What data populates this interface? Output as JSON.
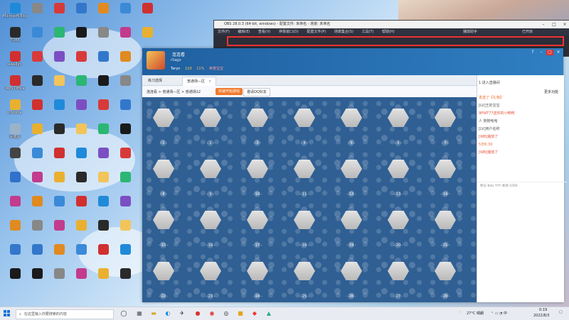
{
  "desktop_icons": [
    {
      "label": "Microsoft Edge",
      "color": "#1f8ad9"
    },
    {
      "label": "TOBE",
      "color": "#2a2a2a"
    },
    {
      "label": "ewellyn",
      "color": "#d03030"
    },
    {
      "label": "WPS Office",
      "color": "#d03030"
    },
    {
      "label": "Chrome",
      "color": "#e9b030"
    },
    {
      "label": "回收站",
      "color": "#9bb3c9"
    },
    {
      "label": "",
      "color": "#444"
    },
    {
      "label": "",
      "color": "#3071c9"
    },
    {
      "label": "",
      "color": "#c23b8c"
    },
    {
      "label": "",
      "color": "#e08a20"
    },
    {
      "label": "",
      "color": "#3377cc"
    },
    {
      "label": "",
      "color": "#1a1a1a"
    },
    {
      "label": "",
      "color": "#888"
    },
    {
      "label": "",
      "color": "#3a8ad8"
    },
    {
      "label": "",
      "color": "#d83a3a"
    }
  ],
  "obs": {
    "title": "OBS 28.0.3 (64-bit, windows) - 配置文件: 未命名 - 场景: 未命名",
    "menu": [
      "文件(F)",
      "编辑(E)",
      "查看(V)",
      "停靠窗口(D)",
      "配置文件(P)",
      "场景集合(S)",
      "工具(T)",
      "帮助(H)"
    ],
    "right_label": "播放助手",
    "right_label2": "已开启"
  },
  "app": {
    "username": "连连看",
    "uid": "r5ago",
    "stat_user": "Taryn",
    "stat_items": [
      "110",
      "11%",
      "荣誉宝宝"
    ],
    "tabs": [
      {
        "label": "练习选择"
      },
      {
        "label": "普通场—区"
      }
    ],
    "breadcrumb": "连连看 > 普通场—区 > 普通场12",
    "btn_start": "快速开始游戏",
    "btn_invite": "邀请QQ好友",
    "seats": [
      "- 1 -",
      "- 2 -",
      "- 3 -",
      "- 4 -",
      "- 5 -",
      "- 6 -",
      "- 7 -",
      "- 8 -",
      "- 9 -",
      "- 10 -",
      "- 11 -",
      "- 12 -",
      "- 13 -",
      "- 14 -",
      "- 15 -",
      "- 16 -",
      "- 17 -",
      "- 18 -",
      "- 19 -",
      "- 20 -",
      "- 21 -",
      "- 22 -",
      "- 23 -",
      "- 24 -",
      "- 25 -",
      "- 26 -",
      "- 27 -",
      "- 28 -"
    ],
    "chat_links": [
      "更多功能"
    ],
    "chat_lines": [
      {
        "text": "1 进入直播间",
        "color": "#444"
      },
      {
        "text": "",
        "color": "#444"
      },
      {
        "text": "发送了【礼物】",
        "color": "#f06a2c"
      },
      {
        "text": "[LV]王的宝宝",
        "color": "#555"
      },
      {
        "text": "9PWT77送你的小鸭鸭",
        "color": "#e8553c"
      },
      {
        "text": "人 随随哈哈",
        "color": "#555"
      },
      {
        "text": "[LV]用户名称",
        "color": "#555"
      },
      {
        "text": "[WB]播放了",
        "color": "#e8553c"
      },
      {
        "text": "5日6:30",
        "color": "#f06a2c"
      },
      {
        "text": "[WB]播放了",
        "color": "#e8553c"
      }
    ],
    "chat_footer": "积分 Bilis YYY   本场 1000"
  },
  "taskbar": {
    "search_placeholder": "在这里输入你要搜索的内容",
    "weather": "27°C 晴朗",
    "time": "0:19",
    "date": "2022/8/3"
  }
}
